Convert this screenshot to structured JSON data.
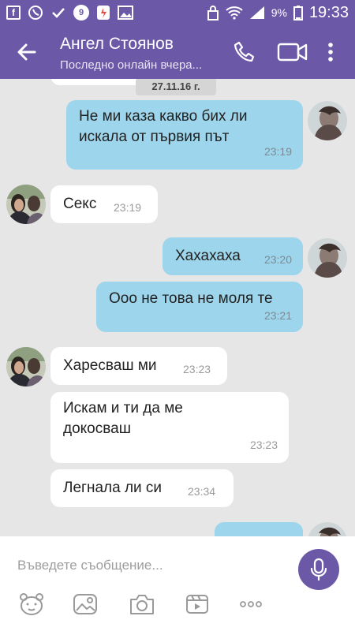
{
  "status_bar": {
    "notif_badge": "9",
    "battery": "9%",
    "time": "19:33"
  },
  "header": {
    "title": "Ангел Стоянов",
    "subtitle": "Последно онлайн вчера..."
  },
  "chat": {
    "date_divider": "27.11.16 г.",
    "messages": [
      {
        "direction": "out",
        "text1": "Не ми каза какво бих ли",
        "text2": "искала от първия път",
        "time": "23:19"
      },
      {
        "direction": "in",
        "text": "Секс",
        "time": "23:19"
      },
      {
        "direction": "out",
        "text": "Хахахаха",
        "time": "23:20"
      },
      {
        "direction": "out",
        "text": "Ооо не това не моля те",
        "time": "23:21"
      },
      {
        "direction": "in",
        "text": "Харесваш ми",
        "time": "23:23"
      },
      {
        "direction": "in",
        "text1": "Искам и ти да ме",
        "text2": "докосваш",
        "time": "23:23"
      },
      {
        "direction": "in",
        "text": "Легнала ли си",
        "time": "23:34"
      }
    ]
  },
  "composer": {
    "placeholder": "Въведете съобщение..."
  },
  "colors": {
    "brand": "#6b59a8",
    "outgoing_bubble": "#9dd6ec",
    "incoming_bubble": "#ffffff",
    "chat_background": "#e6e6e6"
  },
  "icons": [
    "facebook-icon",
    "viber-icon",
    "check-icon",
    "notification-badge-icon",
    "app-icon",
    "gallery-icon",
    "lock-icon",
    "wifi-icon",
    "signal-icon",
    "battery-icon",
    "back-arrow-icon",
    "phone-icon",
    "video-icon",
    "more-vert-icon",
    "mic-icon",
    "sticker-icon",
    "image-icon",
    "camera-icon",
    "gif-icon",
    "more-horiz-icon"
  ]
}
